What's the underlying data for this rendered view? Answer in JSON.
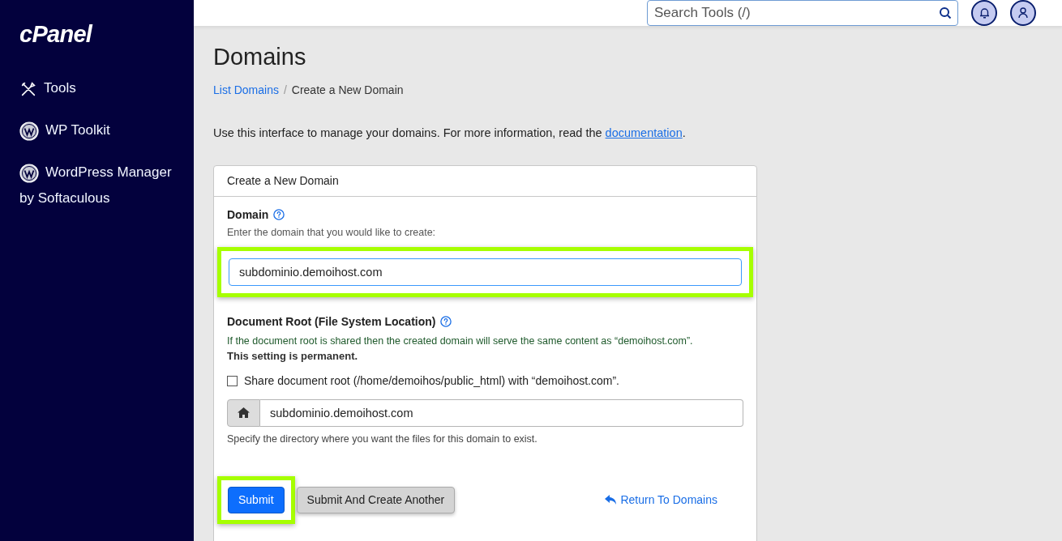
{
  "sidebar": {
    "logo": "cPanel",
    "items": [
      {
        "kind": "tools",
        "label": "Tools"
      },
      {
        "kind": "wordpress",
        "label": "WP Toolkit"
      },
      {
        "kind": "wordpress",
        "label": "WordPress Manager by Softaculous"
      }
    ]
  },
  "header": {
    "search": {
      "placeholder": "Search Tools (/)"
    }
  },
  "page": {
    "title": "Domains",
    "breadcrumb_separator": "/",
    "breadcrumb": [
      {
        "label": "List Domains",
        "link": true
      },
      {
        "label": "Create a New Domain",
        "link": false
      }
    ],
    "intro": "Use this interface to manage your domains. For more information, read the",
    "intro_link": "documentation",
    "intro_end": "."
  },
  "form": {
    "title": "Create a New Domain",
    "domain": {
      "label": "Domain",
      "help": "Enter the domain that you would like to create:",
      "value": "subdominio.demoihost.com",
      "highlighted": true
    },
    "docroot": {
      "label": "Document Root (File System Location)",
      "note": "If the document root is shared then the created domain will serve the same content as “demoihost.com”.",
      "note_bold": "This setting is permanent.",
      "share_label": "Share document root (/home/demoihos/public_html) with “demoihost.com”.",
      "checked": false,
      "value": "subdominio.demoihost.com",
      "hint": "Specify the directory where you want the files for this domain to exist."
    },
    "buttons": [
      {
        "kind": "primary",
        "label": "Submit",
        "highlighted": true
      },
      {
        "kind": "secondary",
        "label": "Submit And Create Another",
        "highlighted": false
      }
    ],
    "return_link": "Return To Domains"
  }
}
